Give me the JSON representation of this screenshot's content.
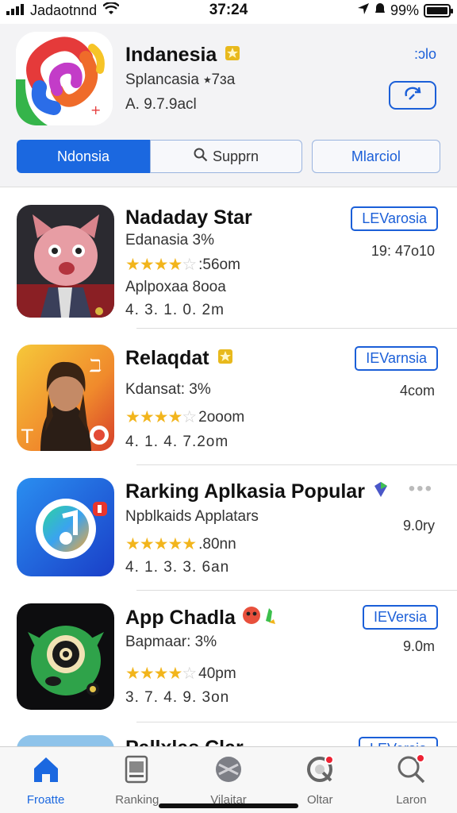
{
  "status_bar": {
    "carrier": "Jadaotnnd",
    "time": "37:24",
    "battery": "99%",
    "battery_level": 0.99
  },
  "featured": {
    "title": "Indanesia",
    "subtitle": "Splancasia ⭑7ɜa",
    "meta": "A. 9.7.9acl",
    "link": ":ɔlo"
  },
  "segmented": {
    "items": [
      "Ndonsia",
      "Supprn",
      "Mlarciol"
    ],
    "active_index": 0
  },
  "apps": [
    {
      "title": "Nadaday Star",
      "badge": "",
      "subtitle": "Edanasia 3%",
      "rating_text": ":56om",
      "rating": 4.5,
      "line3": "Aplpoxaa 8ooa",
      "meta": "4. 3. 1. 0. 2m",
      "button": "LEVarosia",
      "side_value": "19: 47o10"
    },
    {
      "title": "Relaqdat",
      "badge": "star",
      "subtitle": "Kdansat: 3%",
      "rating_text": "2ooom",
      "rating": 4.5,
      "line3": "",
      "meta": "4. 1. 4. 7.2om",
      "button": "IEVarnsia",
      "side_value": "4com"
    },
    {
      "title": "Rarking Aplkasia Popular",
      "badge": "gem",
      "subtitle": "Npblkaids Applatars",
      "rating_text": ".80nn",
      "rating": 5,
      "line3": "",
      "meta": "4. 1. 3. 3. 6an",
      "button": "",
      "side_value": "9.0ry"
    },
    {
      "title": "App Chadla",
      "badge": "emoji",
      "subtitle": "Bapmaar: 3%",
      "rating_text": "40pm",
      "rating": 4,
      "line3": "",
      "meta": "3. 7. 4. 9. 3on",
      "button": "IEVersia",
      "side_value": "9.0m"
    }
  ],
  "partial_row": {
    "title": "Pallxlas Clar",
    "button": "LEVersia"
  },
  "tabs": [
    {
      "label": "Froatte",
      "icon": "home-icon"
    },
    {
      "label": "Ranking",
      "icon": "ranking-icon"
    },
    {
      "label": "Vilaitar",
      "icon": "discover-icon"
    },
    {
      "label": "Oltar",
      "icon": "games-icon"
    },
    {
      "label": "Laron",
      "icon": "search-icon"
    }
  ],
  "colors": {
    "accent": "#1b68e0",
    "star": "#f2b51c"
  }
}
